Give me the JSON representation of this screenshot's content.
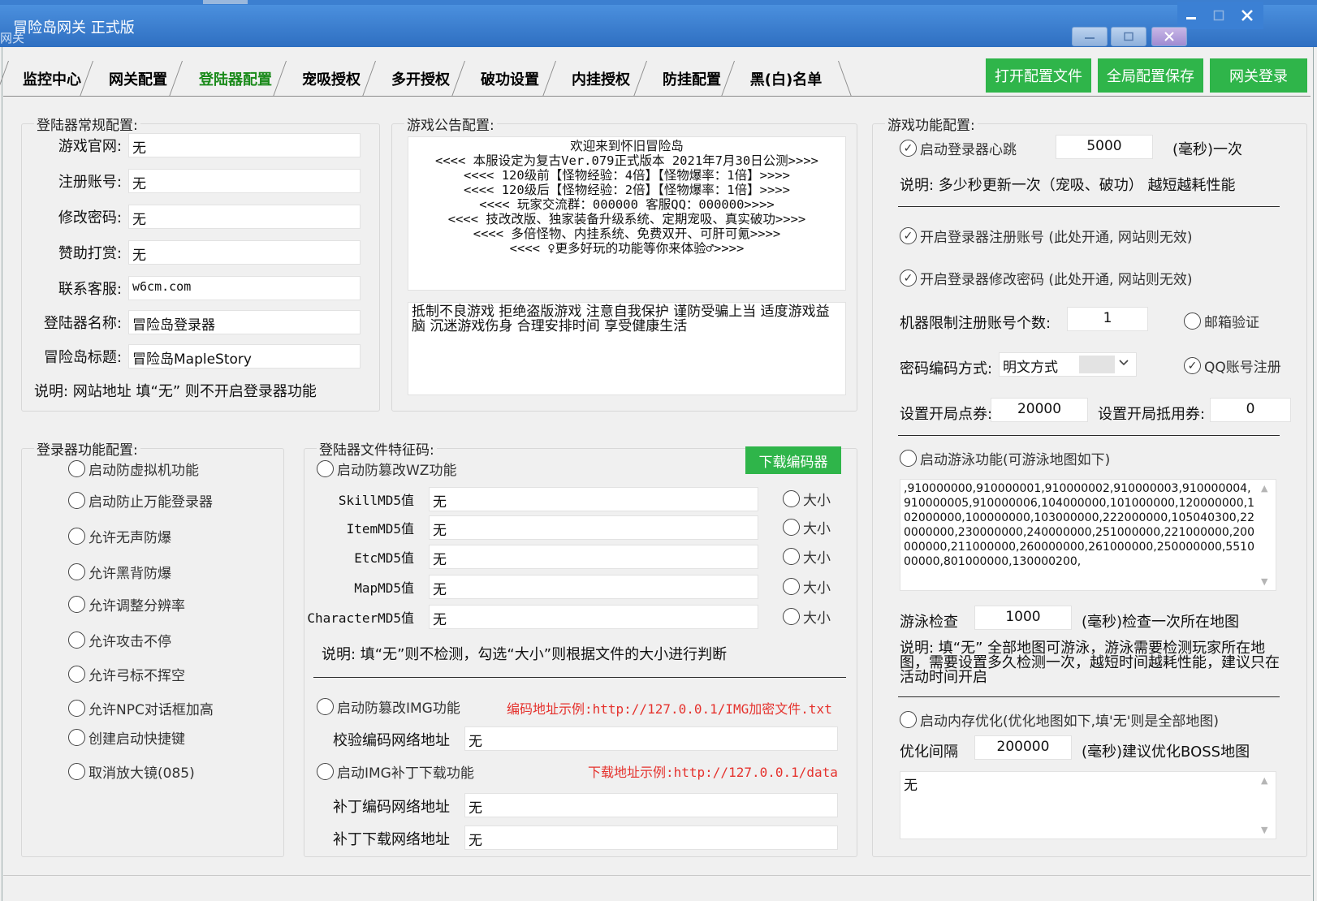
{
  "window": {
    "title": "冒险岛网关 正式版",
    "title_ghost": "网关"
  },
  "tabs": [
    "监控中心",
    "网关配置",
    "登陆器配置",
    "宠吸授权",
    "多开授权",
    "破功设置",
    "内挂授权",
    "防挂配置",
    "黑(白)名单"
  ],
  "active_tab": "登陆器配置",
  "toolbar": {
    "open_config": "打开配置文件",
    "save_global": "全局配置保存",
    "gateway_login": "网关登录"
  },
  "launcher_general": {
    "title": "登陆器常规配置:",
    "fields": [
      {
        "label": "游戏官网:",
        "value": "无"
      },
      {
        "label": "注册账号:",
        "value": "无"
      },
      {
        "label": "修改密码:",
        "value": "无"
      },
      {
        "label": "赞助打赏:",
        "value": "无"
      },
      {
        "label": "联系客服:",
        "value": "w6cm.com"
      },
      {
        "label": "登陆器名称:",
        "value": "冒险岛登录器"
      },
      {
        "label": "冒险岛标题:",
        "value": "冒险岛MapleStory"
      }
    ],
    "note": "说明: 网站地址 填“无” 则不开启登录器功能"
  },
  "notice": {
    "title": "游戏公告配置:",
    "announcement": "欢迎来到怀旧冒险岛\n<<<< 本服设定为复古Ver.079正式版本 2021年7月30日公测>>>>\n<<<< 120级前【怪物经验：4倍】【怪物爆率：1倍】>>>>\n<<<< 120级后【怪物经验：2倍】【怪物爆率：1倍】>>>>\n<<<< 玩家交流群：000000 客服QQ：000000>>>>\n<<<< 技改改版、独家装备升级系统、定期宠吸、真实破功>>>>\n<<<< 多倍怪物、内挂系统、免费双开、可肝可氪>>>>\n<<<< ♀更多好玩的功能等你来体验♂>>>>",
    "health_warning": "抵制不良游戏  拒绝盗版游戏  注意自我保护  谨防受骗上当  适度游戏益脑  沉迷游戏伤身  合理安排时间  享受健康生活"
  },
  "launcher_features": {
    "title": "登录器功能配置:",
    "options": [
      "启动防虚拟机功能",
      "启动防止万能登录器",
      "允许无声防爆",
      "允许黑背防爆",
      "允许调整分辨率",
      "允许攻击不停",
      "允许弓标不挥空",
      "允许NPC对话框加高",
      "创建启动快捷键",
      "取消放大镜(085)"
    ]
  },
  "file_signature": {
    "title": "登陆器文件特征码:",
    "wz_toggle": "启动防篡改WZ功能",
    "download_encoder": "下载编码器",
    "rows": [
      {
        "label": "SkillMD5值",
        "value": "无",
        "size": "大小"
      },
      {
        "label": "ItemMD5值",
        "value": "无",
        "size": "大小"
      },
      {
        "label": "EtcMD5值",
        "value": "无",
        "size": "大小"
      },
      {
        "label": "MapMD5值",
        "value": "无",
        "size": "大小"
      },
      {
        "label": "CharacterMD5值",
        "value": "无",
        "size": "大小"
      }
    ],
    "note": "说明: 填“无”则不检测，勾选“大小”则根据文件的大小进行判断",
    "img_toggle": "启动防篡改IMG功能",
    "img_example": "编码地址示例:http://127.0.0.1/IMG加密文件.txt",
    "verify_url_label": "校验编码网络地址",
    "verify_url_value": "无",
    "patch_toggle": "启动IMG补丁下载功能",
    "patch_example": "下载地址示例:http://127.0.0.1/data",
    "patch_encode_label": "补丁编码网络地址",
    "patch_encode_value": "无",
    "patch_download_label": "补丁下载网络地址",
    "patch_download_value": "无"
  },
  "game_features": {
    "title": "游戏功能配置:",
    "heartbeat_label": "启动登录器心跳",
    "heartbeat_value": "5000",
    "heartbeat_unit": "(毫秒)一次",
    "heartbeat_note": "说明: 多少秒更新一次（宠吸、破功） 越短越耗性能",
    "enable_register": "开启登录器注册账号 (此处开通, 网站则无效)",
    "enable_change_pwd": "开启登录器修改密码 (此处开通, 网站则无效)",
    "machine_limit_label": "机器限制注册账号个数:",
    "machine_limit_value": "1",
    "email_verify": "邮箱验证",
    "pwd_encoding_label": "密码编码方式:",
    "pwd_encoding_value": "明文方式",
    "qq_register": "QQ账号注册",
    "start_points_label": "设置开局点券:",
    "start_points_value": "20000",
    "start_voucher_label": "设置开局抵用券:",
    "start_voucher_value": "0",
    "swim_toggle": "启动游泳功能(可游泳地图如下)",
    "swim_maps": ",910000000,910000001,910000002,910000003,910000004,910000005,910000006,104000000,101000000,120000000,102000000,100000000,103000000,222000000,105040300,220000000,230000000,240000000,251000000,221000000,200000000,211000000,260000000,261000000,250000000,551000000,801000000,130000200,",
    "swim_check_label": "游泳检查",
    "swim_check_value": "1000",
    "swim_check_unit": "(毫秒)检查一次所在地图",
    "swim_note": "说明: 填“无” 全部地图可游泳，游泳需要检测玩家所在地图，需要设置多久检测一次，越短时间越耗性能，建议只在活动时间开启",
    "memory_toggle": "启动内存优化(优化地图如下,填'无'则是全部地图)",
    "opt_interval_label": "优化间隔",
    "opt_interval_value": "200000",
    "opt_interval_unit": "(毫秒)建议优化BOSS地图",
    "opt_maps": "无"
  },
  "colors": {
    "title_bar": "#3b80d4",
    "green_button": "#2fb54a",
    "active_tab_text": "#1a8a1a",
    "example_red": "#e5322d"
  }
}
